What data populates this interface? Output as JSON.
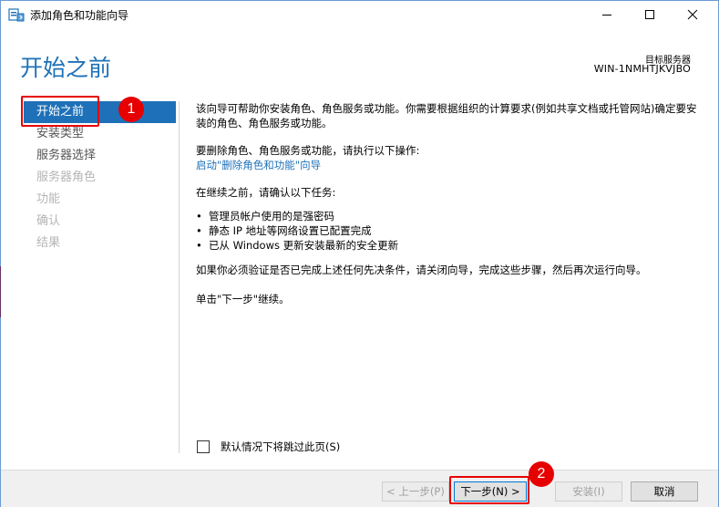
{
  "window": {
    "title": "添加角色和功能向导",
    "app_icon": "server-wizard-icon"
  },
  "header": {
    "page_title": "开始之前",
    "destination_label": "目标服务器",
    "destination_server": "WIN-1NMHTJKVJBO"
  },
  "nav": {
    "items": [
      {
        "label": "开始之前",
        "state": "active"
      },
      {
        "label": "安装类型",
        "state": "enabled"
      },
      {
        "label": "服务器选择",
        "state": "enabled"
      },
      {
        "label": "服务器角色",
        "state": "disabled"
      },
      {
        "label": "功能",
        "state": "disabled"
      },
      {
        "label": "确认",
        "state": "disabled"
      },
      {
        "label": "结果",
        "state": "disabled"
      }
    ]
  },
  "content": {
    "intro": "该向导可帮助你安装角色、角色服务或功能。你需要根据组织的计算要求(例如共享文档或托管网站)确定要安装的角色、角色服务或功能。",
    "remove_intro": "要删除角色、角色服务或功能，请执行以下操作:",
    "remove_link": "启动\"删除角色和功能\"向导",
    "confirm_intro": "在继续之前，请确认以下任务:",
    "tasks": [
      "管理员帐户使用的是强密码",
      "静态 IP 地址等网络设置已配置完成",
      "已从 Windows 更新安装最新的安全更新"
    ],
    "verify_text": "如果你必须验证是否已完成上述任何先决条件，请关闭向导，完成这些步骤，然后再次运行向导。",
    "continue_text": "单击\"下一步\"继续。",
    "skip_checkbox_label": "默认情况下将跳过此页(S)",
    "skip_checkbox_checked": false
  },
  "footer": {
    "prev_label": "< 上一步(P)",
    "next_label": "下一步(N) >",
    "install_label": "安装(I)",
    "cancel_label": "取消"
  },
  "annotations": {
    "badge_1": "1",
    "badge_2": "2",
    "highlight_color": "#e60000"
  },
  "colors": {
    "accent": "#1e71b8",
    "footer_bg": "#f0f0f0"
  }
}
